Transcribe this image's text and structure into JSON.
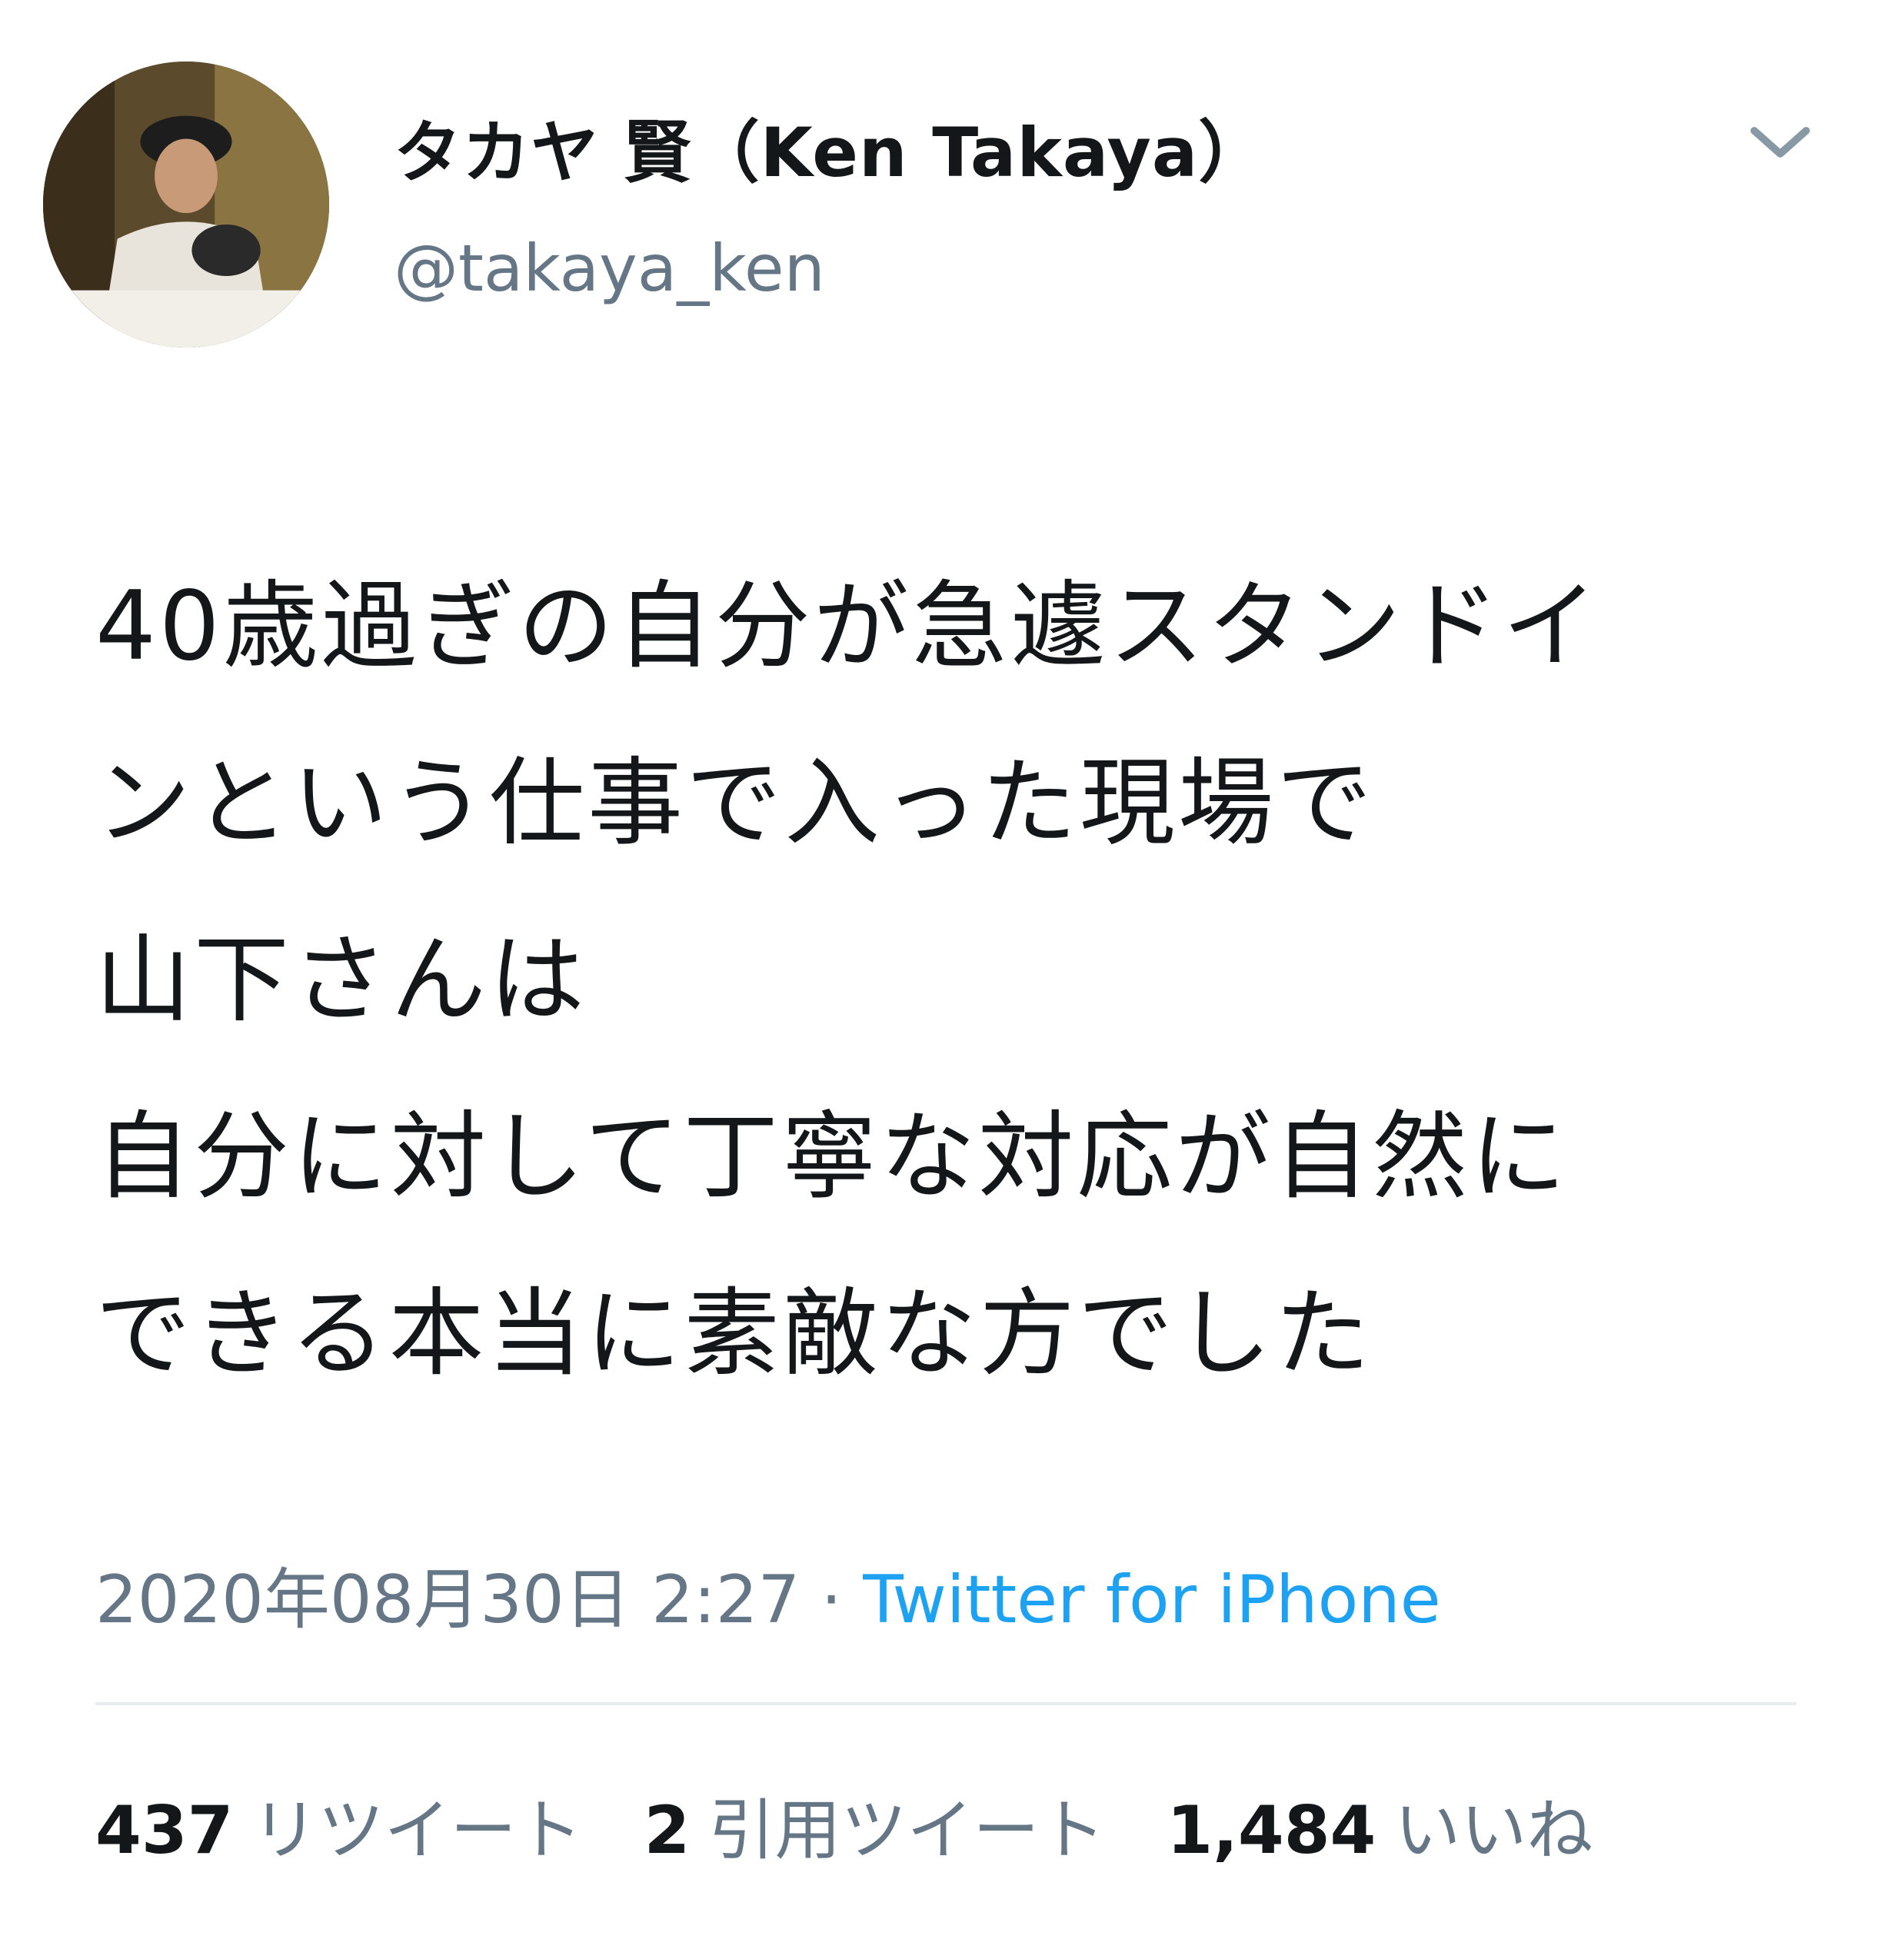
{
  "user": {
    "display_name": "タカヤ 賢（Ken Takaya）",
    "handle": "@takaya_ken",
    "avatar_icon": "user-avatar"
  },
  "menu_icon": "chevron-down-icon",
  "tweet": {
    "text": "40歳過ぎの自分が急遽スタンドイ\nンという仕事で入った現場で\n山下さんは\n自分に対して丁寧な対応が自然に\nできる本当に素敵な方でした"
  },
  "meta": {
    "timestamp": "2020年08月30日 2:27",
    "separator": " · ",
    "source": "Twitter for iPhone"
  },
  "stats": {
    "retweets_count": "437",
    "retweets_label": "リツイート",
    "quotes_count": "2",
    "quotes_label": "引用ツイート",
    "likes_count": "1,484",
    "likes_label": "いいね"
  },
  "colors": {
    "text": "#14171a",
    "secondary": "#657786",
    "link": "#1da1f2",
    "divider": "#e6ecf0"
  }
}
